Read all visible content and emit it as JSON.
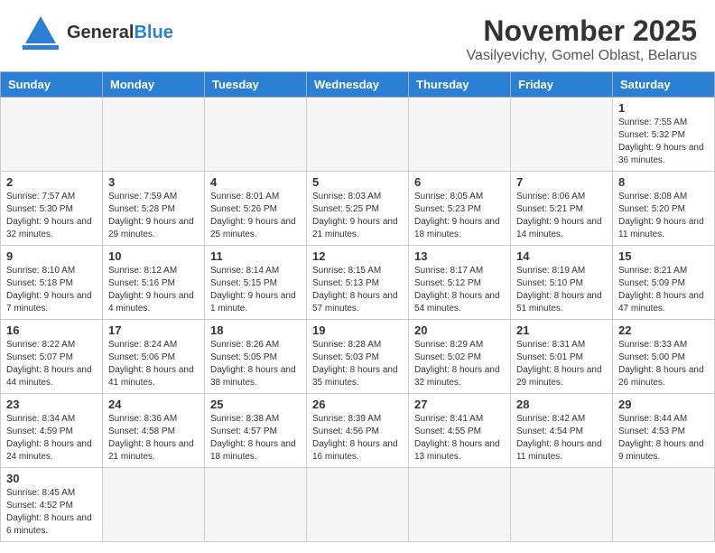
{
  "header": {
    "logo_general": "General",
    "logo_blue": "Blue",
    "month_year": "November 2025",
    "location": "Vasilyevichy, Gomel Oblast, Belarus"
  },
  "weekdays": [
    "Sunday",
    "Monday",
    "Tuesday",
    "Wednesday",
    "Thursday",
    "Friday",
    "Saturday"
  ],
  "weeks": [
    [
      {
        "day": "",
        "info": ""
      },
      {
        "day": "",
        "info": ""
      },
      {
        "day": "",
        "info": ""
      },
      {
        "day": "",
        "info": ""
      },
      {
        "day": "",
        "info": ""
      },
      {
        "day": "",
        "info": ""
      },
      {
        "day": "1",
        "info": "Sunrise: 7:55 AM\nSunset: 5:32 PM\nDaylight: 9 hours and 36 minutes."
      }
    ],
    [
      {
        "day": "2",
        "info": "Sunrise: 7:57 AM\nSunset: 5:30 PM\nDaylight: 9 hours and 32 minutes."
      },
      {
        "day": "3",
        "info": "Sunrise: 7:59 AM\nSunset: 5:28 PM\nDaylight: 9 hours and 29 minutes."
      },
      {
        "day": "4",
        "info": "Sunrise: 8:01 AM\nSunset: 5:26 PM\nDaylight: 9 hours and 25 minutes."
      },
      {
        "day": "5",
        "info": "Sunrise: 8:03 AM\nSunset: 5:25 PM\nDaylight: 9 hours and 21 minutes."
      },
      {
        "day": "6",
        "info": "Sunrise: 8:05 AM\nSunset: 5:23 PM\nDaylight: 9 hours and 18 minutes."
      },
      {
        "day": "7",
        "info": "Sunrise: 8:06 AM\nSunset: 5:21 PM\nDaylight: 9 hours and 14 minutes."
      },
      {
        "day": "8",
        "info": "Sunrise: 8:08 AM\nSunset: 5:20 PM\nDaylight: 9 hours and 11 minutes."
      }
    ],
    [
      {
        "day": "9",
        "info": "Sunrise: 8:10 AM\nSunset: 5:18 PM\nDaylight: 9 hours and 7 minutes."
      },
      {
        "day": "10",
        "info": "Sunrise: 8:12 AM\nSunset: 5:16 PM\nDaylight: 9 hours and 4 minutes."
      },
      {
        "day": "11",
        "info": "Sunrise: 8:14 AM\nSunset: 5:15 PM\nDaylight: 9 hours and 1 minute."
      },
      {
        "day": "12",
        "info": "Sunrise: 8:15 AM\nSunset: 5:13 PM\nDaylight: 8 hours and 57 minutes."
      },
      {
        "day": "13",
        "info": "Sunrise: 8:17 AM\nSunset: 5:12 PM\nDaylight: 8 hours and 54 minutes."
      },
      {
        "day": "14",
        "info": "Sunrise: 8:19 AM\nSunset: 5:10 PM\nDaylight: 8 hours and 51 minutes."
      },
      {
        "day": "15",
        "info": "Sunrise: 8:21 AM\nSunset: 5:09 PM\nDaylight: 8 hours and 47 minutes."
      }
    ],
    [
      {
        "day": "16",
        "info": "Sunrise: 8:22 AM\nSunset: 5:07 PM\nDaylight: 8 hours and 44 minutes."
      },
      {
        "day": "17",
        "info": "Sunrise: 8:24 AM\nSunset: 5:06 PM\nDaylight: 8 hours and 41 minutes."
      },
      {
        "day": "18",
        "info": "Sunrise: 8:26 AM\nSunset: 5:05 PM\nDaylight: 8 hours and 38 minutes."
      },
      {
        "day": "19",
        "info": "Sunrise: 8:28 AM\nSunset: 5:03 PM\nDaylight: 8 hours and 35 minutes."
      },
      {
        "day": "20",
        "info": "Sunrise: 8:29 AM\nSunset: 5:02 PM\nDaylight: 8 hours and 32 minutes."
      },
      {
        "day": "21",
        "info": "Sunrise: 8:31 AM\nSunset: 5:01 PM\nDaylight: 8 hours and 29 minutes."
      },
      {
        "day": "22",
        "info": "Sunrise: 8:33 AM\nSunset: 5:00 PM\nDaylight: 8 hours and 26 minutes."
      }
    ],
    [
      {
        "day": "23",
        "info": "Sunrise: 8:34 AM\nSunset: 4:59 PM\nDaylight: 8 hours and 24 minutes."
      },
      {
        "day": "24",
        "info": "Sunrise: 8:36 AM\nSunset: 4:58 PM\nDaylight: 8 hours and 21 minutes."
      },
      {
        "day": "25",
        "info": "Sunrise: 8:38 AM\nSunset: 4:57 PM\nDaylight: 8 hours and 18 minutes."
      },
      {
        "day": "26",
        "info": "Sunrise: 8:39 AM\nSunset: 4:56 PM\nDaylight: 8 hours and 16 minutes."
      },
      {
        "day": "27",
        "info": "Sunrise: 8:41 AM\nSunset: 4:55 PM\nDaylight: 8 hours and 13 minutes."
      },
      {
        "day": "28",
        "info": "Sunrise: 8:42 AM\nSunset: 4:54 PM\nDaylight: 8 hours and 11 minutes."
      },
      {
        "day": "29",
        "info": "Sunrise: 8:44 AM\nSunset: 4:53 PM\nDaylight: 8 hours and 9 minutes."
      }
    ],
    [
      {
        "day": "30",
        "info": "Sunrise: 8:45 AM\nSunset: 4:52 PM\nDaylight: 8 hours and 6 minutes."
      },
      {
        "day": "",
        "info": ""
      },
      {
        "day": "",
        "info": ""
      },
      {
        "day": "",
        "info": ""
      },
      {
        "day": "",
        "info": ""
      },
      {
        "day": "",
        "info": ""
      },
      {
        "day": "",
        "info": ""
      }
    ]
  ]
}
